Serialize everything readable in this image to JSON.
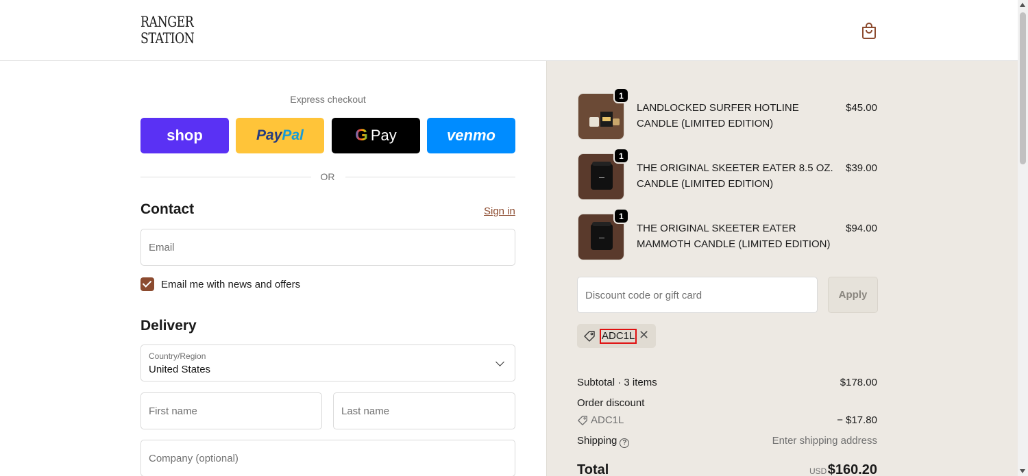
{
  "header": {
    "logo_line1": "RANGER",
    "logo_line2": "STATION",
    "cart_icon": "shopping-bag-icon"
  },
  "express": {
    "title": "Express checkout",
    "shop_label": "shop",
    "paypal_part1": "Pay",
    "paypal_part2": "Pal",
    "gpay_g": "G",
    "gpay_label": "Pay",
    "venmo_label": "venmo",
    "or_label": "OR"
  },
  "contact": {
    "heading": "Contact",
    "sign_in": "Sign in",
    "email_placeholder": "Email",
    "newsletter_label": "Email me with news and offers",
    "newsletter_checked": true
  },
  "delivery": {
    "heading": "Delivery",
    "country_label": "Country/Region",
    "country_value": "United States",
    "first_name_placeholder": "First name",
    "last_name_placeholder": "Last name",
    "company_placeholder": "Company (optional)"
  },
  "summary": {
    "items": [
      {
        "name": "LANDLOCKED SURFER HOTLINE CANDLE (LIMITED EDITION)",
        "price": "$45.00",
        "qty": "1"
      },
      {
        "name": "THE ORIGINAL SKEETER EATER 8.5 OZ. CANDLE (LIMITED EDITION)",
        "price": "$39.00",
        "qty": "1"
      },
      {
        "name": "THE ORIGINAL SKEETER EATER MAMMOTH CANDLE (LIMITED EDITION)",
        "price": "$94.00",
        "qty": "1"
      }
    ],
    "discount_placeholder": "Discount code or gift card",
    "apply_label": "Apply",
    "applied_code": "ADC1L",
    "remove_symbol": "✕",
    "subtotal_label": "Subtotal · 3 items",
    "subtotal_value": "$178.00",
    "order_discount_label": "Order discount",
    "discount_code": "ADC1L",
    "discount_value": "− $17.80",
    "shipping_label": "Shipping",
    "shipping_help": "?",
    "shipping_value": "Enter shipping address",
    "total_label": "Total",
    "total_currency": "USD",
    "total_value": "$160.20"
  },
  "colors": {
    "accent": "#8c4b2f",
    "summary_bg": "#ede9e3",
    "shop_pay": "#5a31f4",
    "paypal": "#ffc439",
    "venmo": "#008cff"
  }
}
